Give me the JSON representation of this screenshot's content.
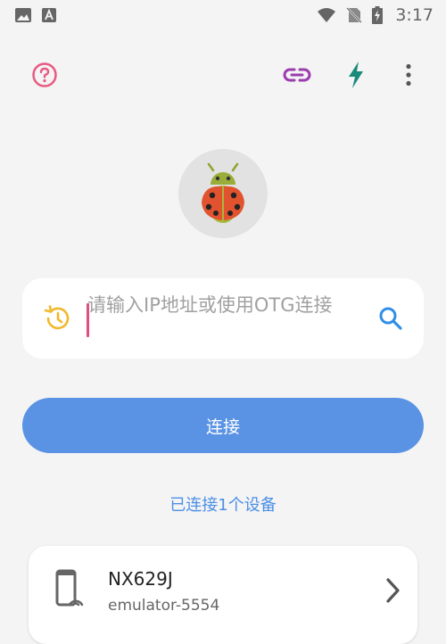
{
  "status_bar": {
    "time": "3:17",
    "icons": [
      "image-icon",
      "text-icon",
      "wifi-icon",
      "no-sim-icon",
      "battery-charging-icon"
    ]
  },
  "toolbar": {
    "icons": [
      "help-icon",
      "link-icon",
      "bolt-icon",
      "more-icon"
    ],
    "colors": {
      "help": "#e85a83",
      "link": "#9c3cb0",
      "bolt": "#1b8a7a",
      "more": "#555555"
    }
  },
  "avatar": {
    "icon": "ladybug-android-icon"
  },
  "input": {
    "placeholder": "请输入IP地址或使用OTG连接",
    "left_icon": "history-icon",
    "right_icon": "search-icon"
  },
  "connect_button": {
    "label": "连接",
    "color": "#5a93e4"
  },
  "connected_count": "已连接1个设备",
  "devices": [
    {
      "name": "NX629J",
      "id": "emulator-5554",
      "icon": "phone-wireless-icon"
    }
  ]
}
